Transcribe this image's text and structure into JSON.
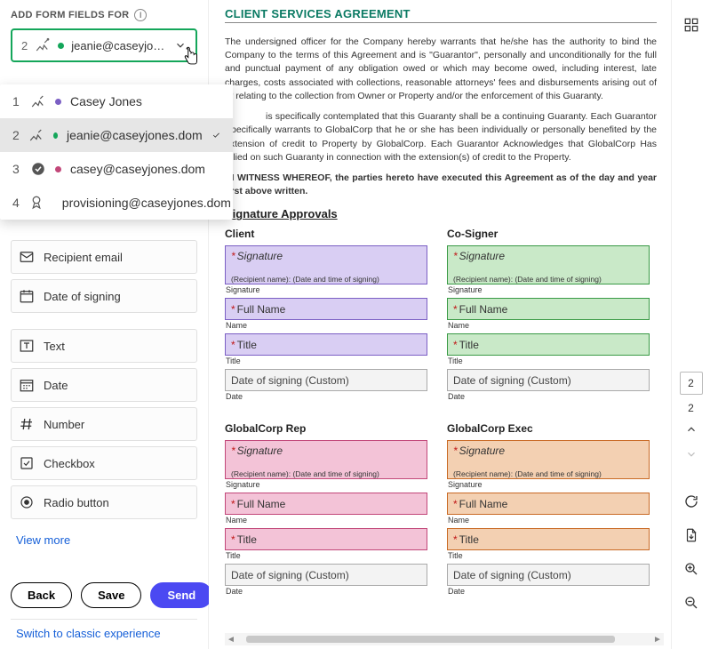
{
  "left": {
    "heading": "ADD FORM FIELDS FOR",
    "selected": {
      "num": "2",
      "label": "jeanie@caseyjon...",
      "dotColor": "#14a65a"
    },
    "dropdown": [
      {
        "num": "1",
        "icon": "sign",
        "dotColor": "#7b5fc4",
        "label": "Casey Jones"
      },
      {
        "num": "2",
        "icon": "sign",
        "dotColor": "#14a65a",
        "label": "jeanie@caseyjones.dom",
        "selected": true
      },
      {
        "num": "3",
        "icon": "approve",
        "dotColor": "#c24779",
        "label": "casey@caseyjones.dom"
      },
      {
        "num": "4",
        "icon": "cc",
        "dotColor": "#c96a25",
        "label": "provisioning@caseyjones.dom"
      }
    ],
    "fieldsA": [
      {
        "icon": "email",
        "label": "Recipient email"
      },
      {
        "icon": "calendar",
        "label": "Date of signing"
      }
    ],
    "fieldsB": [
      {
        "icon": "text",
        "label": "Text"
      },
      {
        "icon": "date",
        "label": "Date"
      },
      {
        "icon": "number",
        "label": "Number"
      },
      {
        "icon": "checkbox",
        "label": "Checkbox"
      },
      {
        "icon": "radio",
        "label": "Radio button"
      }
    ],
    "viewMore": "View more",
    "buttons": {
      "back": "Back",
      "save": "Save",
      "send": "Send"
    },
    "classic": "Switch to classic experience"
  },
  "doc": {
    "title": "CLIENT SERVICES AGREEMENT",
    "p1": "The undersigned officer for the Company hereby warrants that he/she has the authority to bind the Company to the terms of this Agreement and is \"Guarantor\", personally and unconditionally for the full and punctual payment of any obligation owed or which may become owed, including interest, late charges, costs associated with collections, reasonable attorneys' fees and disbursements arising out of or relating to the collection from Owner or Property and/or the enforcement of this Guaranty.",
    "p2": "is specifically contemplated that this Guaranty shall be a continuing Guaranty. Each Guarantor Specifically warrants to GlobalCorp that he or she has been individually or personally benefited by the extension of credit to Property by GlobalCorp. Each Guarantor Acknowledges that GlobalCorp Has relied on such Guaranty in connection with the extension(s) of credit to the Property.",
    "p3": "IN WITNESS WHEREOF, the parties hereto have executed this Agreement as of the day and year first above written.",
    "sectionHead": "Signature Approvals",
    "roles": [
      "Client",
      "Co-Signer",
      "GlobalCorp Rep",
      "GlobalCorp Exec"
    ],
    "colors": [
      "c-purple",
      "c-green",
      "c-pink",
      "c-orange"
    ],
    "labels": {
      "signature": "Signature",
      "subline": "(Recipient name): (Date and time of signing)",
      "sigCap": "Signature",
      "fullName": "Full Name",
      "nameCap": "Name",
      "title": "Title",
      "titleCap": "Title",
      "date": "Date of signing (Custom)",
      "dateCap": "Date"
    }
  },
  "right": {
    "pages": "2",
    "currentPage": "2"
  }
}
